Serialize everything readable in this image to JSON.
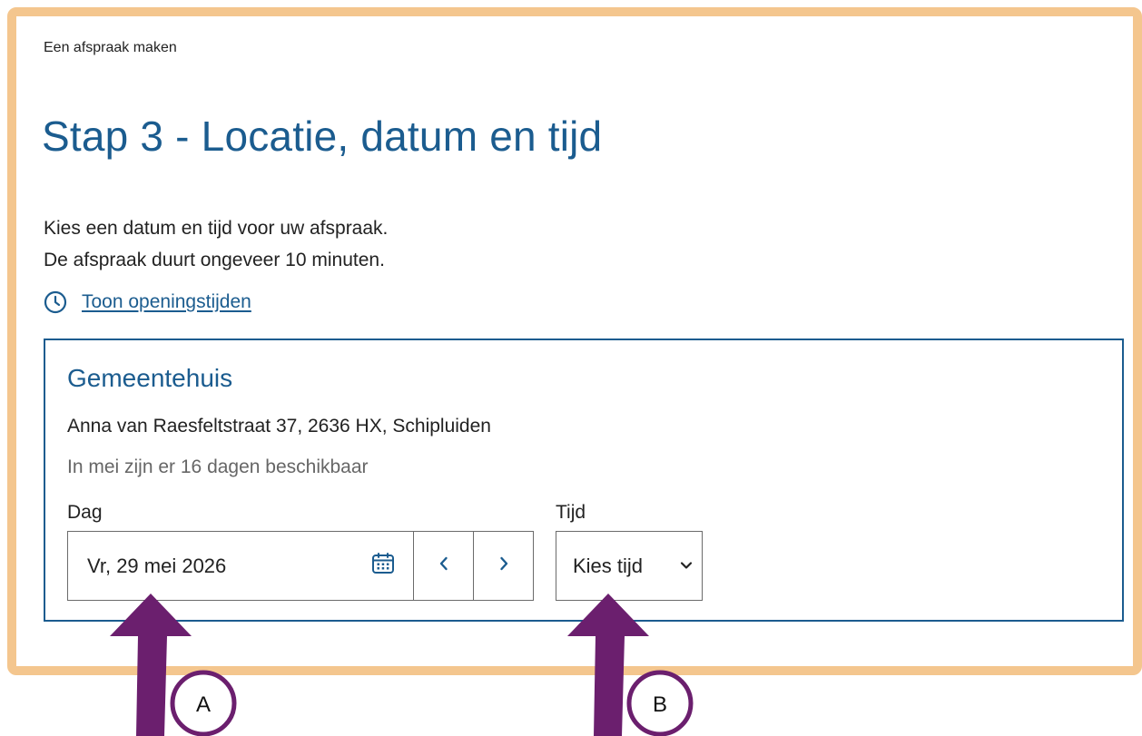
{
  "breadcrumb": "Een afspraak maken",
  "page_title": "Stap 3 - Locatie, datum en tijd",
  "intro": {
    "line1": "Kies een datum en tijd voor uw afspraak.",
    "line2": "De afspraak duurt ongeveer 10 minuten."
  },
  "hours_link": {
    "icon": "clock-icon",
    "label": "Toon openingstijden"
  },
  "location": {
    "name": "Gemeentehuis",
    "address": "Anna van Raesfeltstraat 37, 2636 HX, Schipluiden",
    "availability": "In mei zijn er 16 dagen beschikbaar"
  },
  "day_field": {
    "label": "Dag",
    "value": "Vr, 29 mei 2026",
    "icons": {
      "calendar": "calendar-icon",
      "prev": "chevron-left-icon",
      "next": "chevron-right-icon"
    }
  },
  "time_field": {
    "label": "Tijd",
    "value": "Kies tijd",
    "icon": "chevron-down-icon"
  },
  "annotations": {
    "a_label": "A",
    "b_label": "B"
  },
  "colors": {
    "accent": "#1b5c8f",
    "frame": "#f4c68e",
    "arrow": "#6b1f6e",
    "muted_text": "#666666"
  }
}
